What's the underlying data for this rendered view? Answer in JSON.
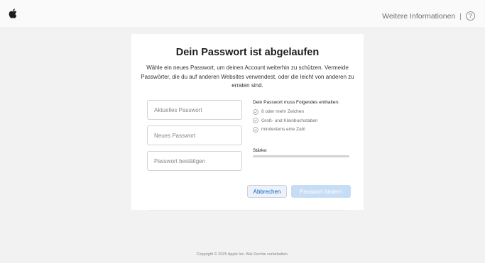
{
  "topbar": {
    "logo_icon": "apple-logo-icon",
    "more_info_link": "Weitere Informationen",
    "separator": "|",
    "help_icon_glyph": "?"
  },
  "card": {
    "title": "Dein Passwort ist abgelaufen",
    "description": "Wähle ein neues Passwort, um deinen Account weiterhin zu schützen. Vermeide Passwörter, die du auf anderen Websites verwendest, oder die leicht von anderen zu erraten sind.",
    "fields": {
      "current": {
        "placeholder": "Aktuelles Passwort",
        "value": ""
      },
      "new": {
        "placeholder": "Neues Passwort",
        "value": ""
      },
      "confirm": {
        "placeholder": "Passwort bestätigen",
        "value": ""
      }
    },
    "requirements": {
      "heading": "Dein Passwort muss Folgendes enthalten:",
      "items": [
        {
          "label": "8 oder mehr Zeichen",
          "icon": "check-circle-icon",
          "met": false
        },
        {
          "label": "Groß- und Kleinbuchstaben",
          "icon": "check-circle-icon",
          "met": false
        },
        {
          "label": "mindestens eine Zahl",
          "icon": "check-circle-icon",
          "met": false
        }
      ]
    },
    "strength": {
      "label": "Stärke:",
      "level": 0
    },
    "buttons": {
      "cancel": "Abbrechen",
      "change": "Passwort ändern"
    }
  },
  "footer": {
    "copyright": "Copyright © 2025 Apple Inc. Alle Rechte vorbehalten."
  },
  "colors": {
    "accent": "#0066cc",
    "disabled_button": "#c7dcf5",
    "page_background": "#f2f2f2"
  }
}
